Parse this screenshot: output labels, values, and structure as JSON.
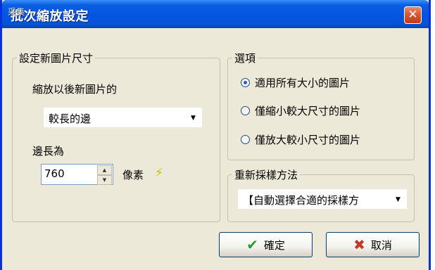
{
  "window": {
    "title": "批次縮放設定",
    "title_overlay": "采集",
    "close_glyph": "✕"
  },
  "size_group": {
    "legend": "設定新圖片尺寸",
    "scale_label": "縮放以後新圖片的",
    "side_select": "較長的邊",
    "length_label": "邊長為",
    "length_value": "760",
    "unit_label": "像素",
    "lightning_icon": "⚡"
  },
  "options_group": {
    "legend": "選項",
    "radios": [
      {
        "label": "適用所有大小的圖片",
        "selected": true
      },
      {
        "label": "僅縮小較大尺寸的圖片",
        "selected": false
      },
      {
        "label": "僅放大較小尺寸的圖片",
        "selected": false
      }
    ]
  },
  "resample_group": {
    "legend": "重新採樣方法",
    "select_value": "【自動選擇合適的採樣方"
  },
  "buttons": {
    "ok_label": "確定",
    "cancel_label": "取消",
    "ok_icon": "✔",
    "cancel_icon": "✖"
  },
  "colors": {
    "title_bar": "#0554e3",
    "dialog_bg": "#ece9d8",
    "close_button": "#c23b13"
  }
}
